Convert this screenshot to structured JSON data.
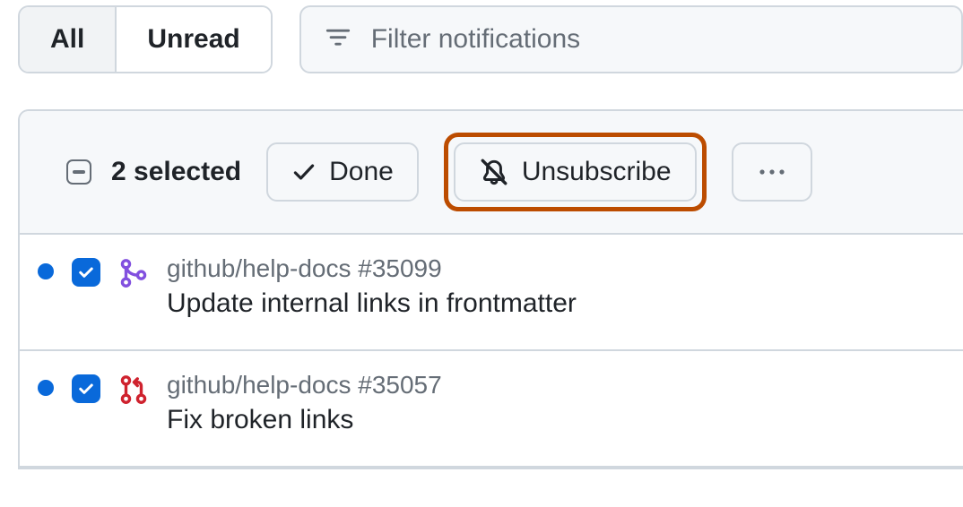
{
  "tabs": {
    "all": "All",
    "unread": "Unread",
    "active": "all"
  },
  "filter": {
    "placeholder": "Filter notifications"
  },
  "toolbar": {
    "selected_label": "2 selected",
    "done_label": "Done",
    "unsubscribe_label": "Unsubscribe"
  },
  "items": [
    {
      "repo": "github/help-docs",
      "ref": "#35099",
      "title": "Update internal links in frontmatter",
      "type": "merged-pr",
      "unread": true,
      "checked": true
    },
    {
      "repo": "github/help-docs",
      "ref": "#35057",
      "title": "Fix broken links",
      "type": "open-pr",
      "unread": true,
      "checked": true
    }
  ]
}
